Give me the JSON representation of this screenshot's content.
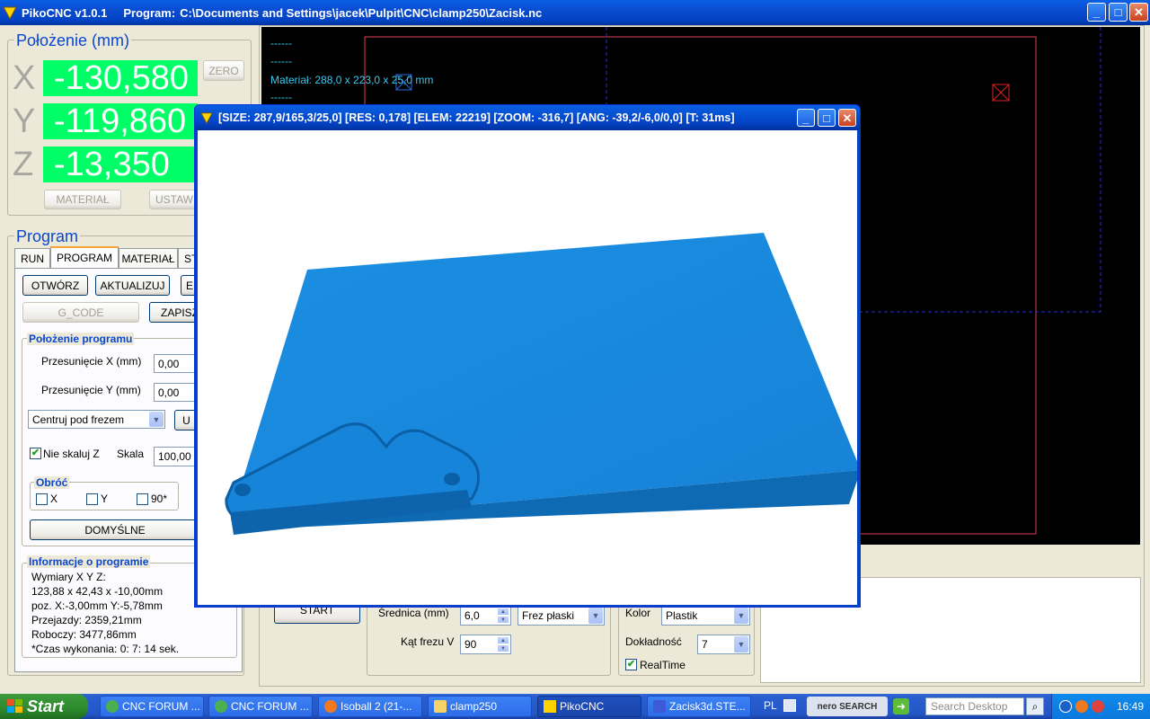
{
  "window": {
    "app_name": "PikoCNC v1.0.1",
    "program_label": "Program:",
    "program_path": "C:\\Documents and Settings\\jacek\\Pulpit\\CNC\\clamp250\\Zacisk.nc",
    "minimize": "_",
    "maximize": "□",
    "close": "✕"
  },
  "position": {
    "title": "Położenie (mm)",
    "x_label": "X",
    "y_label": "Y",
    "z_label": "Z",
    "x_value": "-130,580",
    "y_value": "-119,860",
    "z_value": "-13,350",
    "zero_button": "ZERO",
    "material_button": "MATERIAŁ",
    "set_button": "USTAW"
  },
  "program": {
    "title": "Program",
    "tabs": [
      "RUN",
      "PROGRAM",
      "MATERIAŁ",
      "ST"
    ],
    "open_button": "OTWÓRZ",
    "update_button": "AKTUALIZUJ",
    "e_button": "E",
    "gcode_button": "G_CODE",
    "save_button": "ZAPISZ",
    "placement_title": "Położenie programu",
    "offset_x_label": "Przesunięcie X (mm)",
    "offset_x_value": "0,00",
    "offset_y_label": "Przesunięcie Y (mm)",
    "offset_y_value": "0,00",
    "center_select": "Centruj pod frezem",
    "u_button": "U",
    "no_scale_z_label": "Nie skaluj Z",
    "scale_label": "Skala",
    "scale_value": "100,00",
    "rotate_title": "Obróć",
    "rot_x": "X",
    "rot_y": "Y",
    "rot_90": "90*",
    "default_button": "DOMYŚLNE",
    "info_title": "Informacje o programie",
    "info_lines": [
      "Wymiary X Y Z:",
      "123,88 x 42,43 x -10,00mm",
      "poz. X:-3,00mm Y:-5,78mm",
      "Przejazdy: 2359,21mm",
      "Roboczy: 3477,86mm",
      "*Czas wykonania: 0: 7: 14 sek."
    ]
  },
  "canvas": {
    "lines": [
      "------",
      "------",
      "Materiał: 288,0 x 223,0 x 25,0 mm",
      "------"
    ]
  },
  "viewer": {
    "title": "[SIZE: 287,9/165,3/25,0] [RES: 0,178] [ELEM: 22219] [ZOOM: -316,7] [ANG: -39,2/-6,0/0,0] [T: 31ms]"
  },
  "bottom": {
    "start_button": "START",
    "diameter_label": "Średnica (mm)",
    "diameter_value": "6,0",
    "cutter_select": "Frez płaski",
    "angle_label": "Kąt frezu V",
    "angle_value": "90",
    "color_label": "Kolor",
    "color_select": "Plastik",
    "accuracy_label": "Dokładność",
    "accuracy_select": "7",
    "realtime_label": "RealTime"
  },
  "taskbar": {
    "start": "Start",
    "tasks": [
      "CNC FORUM ...",
      "CNC FORUM ...",
      "Isoball 2 (21-...",
      "clamp250",
      "PikoCNC",
      "Zacisk3d.STE..."
    ],
    "lang": "PL",
    "search_placeholder": "Search Desktop",
    "nero": "nero SEARCH",
    "time": "16:49"
  },
  "colors": {
    "lcd": "#00ff66",
    "model_blue": "#1a86d8",
    "canvas_text": "#38c8f0",
    "xp_blue": "#0343c4"
  }
}
